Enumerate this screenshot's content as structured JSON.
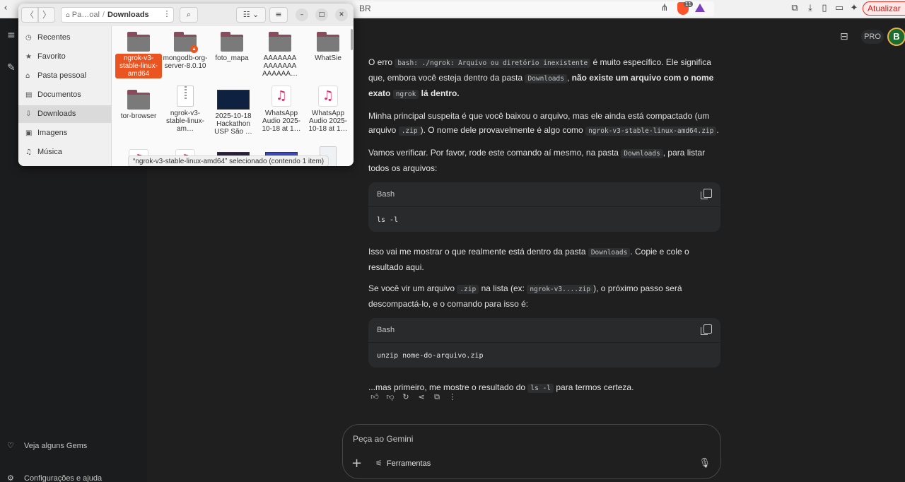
{
  "browser": {
    "url_suffix": "BR",
    "update_label": "Atualizar",
    "brave_count": "11"
  },
  "sidebar": {
    "gems_label": "Veja alguns Gems",
    "settings_label": "Configurações e ajuda"
  },
  "header": {
    "pro_label": "PRO",
    "avatar_initial": "B"
  },
  "message": {
    "p1": {
      "t1": "O erro ",
      "c1": "bash: ./ngrok: Arquivo ou diretório inexistente",
      "t2": " é muito específico. Ele significa que, embora você esteja dentro da pasta ",
      "c2": "Downloads",
      "t3": ", ",
      "b1": "não existe um arquivo com o nome exato ",
      "c3": "ngrok",
      "b2": " lá dentro."
    },
    "p2": {
      "t1": "Minha principal suspeita é que você baixou o arquivo, mas ele ainda está compactado (um arquivo ",
      "c1": ".zip",
      "t2": "). O nome dele provavelmente é algo como ",
      "c2": "ngrok-v3-stable-linux-amd64.zip",
      "t3": "."
    },
    "p3": {
      "t1": "Vamos verificar. Por favor, rode este comando aí mesmo, na pasta ",
      "c1": "Downloads",
      "t2": ", para listar todos os arquivos:"
    },
    "code1": {
      "lang": "Bash",
      "code": "ls -l"
    },
    "p4": {
      "t1": "Isso vai me mostrar o que realmente está dentro da pasta ",
      "c1": "Downloads",
      "t2": ". Copie e cole o resultado aqui."
    },
    "p5": {
      "t1": "Se você vir um arquivo ",
      "c1": ".zip",
      "t2": " na lista (ex: ",
      "c2": "ngrok-v3....zip",
      "t3": "), o próximo passo será descompactá-lo, e o comando para isso é:"
    },
    "code2": {
      "lang": "Bash",
      "code": "unzip nome-do-arquivo.zip"
    },
    "p6": {
      "t1": "...mas primeiro, me mostre o resultado do ",
      "c1": "ls -l",
      "t2": " para termos certeza."
    }
  },
  "input": {
    "placeholder": "Peça ao Gemini",
    "tools_label": "Ferramentas"
  },
  "file_manager": {
    "path_crumb": "Pa…oal",
    "path_current": "Downloads",
    "places": [
      {
        "label": "Recentes",
        "icon": "clock-icon"
      },
      {
        "label": "Favorito",
        "icon": "star-icon"
      },
      {
        "label": "Pasta pessoal",
        "icon": "home-icon"
      },
      {
        "label": "Documentos",
        "icon": "document-icon"
      },
      {
        "label": "Downloads",
        "icon": "download-icon"
      },
      {
        "label": "Imagens",
        "icon": "image-icon"
      },
      {
        "label": "Música",
        "icon": "music-icon"
      }
    ],
    "files": [
      {
        "name": "ngrok-v3-stable-linux-amd64",
        "kind": "folder",
        "selected": true
      },
      {
        "name": "mongodb-org-server-8.0.10",
        "kind": "folder-locked"
      },
      {
        "name": "foto_mapa",
        "kind": "folder"
      },
      {
        "name": "AAAAAAA AAAAAAA AAAAAA…",
        "kind": "folder"
      },
      {
        "name": "WhatSie",
        "kind": "folder"
      },
      {
        "name": "tor-browser",
        "kind": "folder"
      },
      {
        "name": "ngrok-v3-stable-linux-am…",
        "kind": "zip"
      },
      {
        "name": "2025-10-18 Hackathon USP São …",
        "kind": "image"
      },
      {
        "name": "WhatsApp Audio 2025-10-18 at 1…",
        "kind": "audio"
      },
      {
        "name": "WhatsApp Audio 2025-10-18 at 1…",
        "kind": "audio"
      }
    ],
    "status": "“ngrok-v3-stable-linux-amd64” selecionado  (contendo 1 item)"
  }
}
